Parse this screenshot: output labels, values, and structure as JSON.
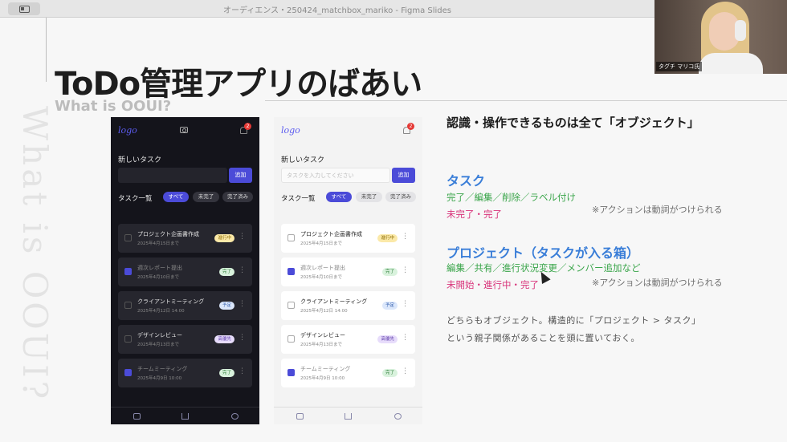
{
  "window": {
    "title": "オーディエンス・250424_matchbox_mariko - Figma Slides"
  },
  "slide": {
    "vertical_text": "What is OOUI?",
    "title": "ToDo管理アプリのばあい",
    "subtitle": "What is OOUI?",
    "heading": "認識・操作できるものは全て「オブジェクト」",
    "task_section": {
      "title": "タスク",
      "actions": "完了／編集／削除／ラベル付け",
      "states": "未完了・完了",
      "note": "※アクションは動詞がつけられる"
    },
    "project_section": {
      "title": "プロジェクト（タスクが入る箱）",
      "actions": "編集／共有／進行状況変更／メンバー追加など",
      "states": "未開始・進行中・完了",
      "note": "※アクションは動詞がつけられる"
    },
    "body_line1": "どちらもオブジェクト。構造的に「プロジェクト > タスク」",
    "body_line2": "という親子関係があることを頭に置いておく。"
  },
  "phone": {
    "logo": "logo",
    "badge": "2",
    "new_task_label": "新しいタスク",
    "input_placeholder": "タスクを入力してください",
    "add_button": "追加",
    "list_label": "タスク一覧",
    "filters": [
      "すべて",
      "未完了",
      "完了済み"
    ],
    "tasks": [
      {
        "name": "プロジェクト企画書作成",
        "date": "2025年4月15日まで",
        "badge": "進行中"
      },
      {
        "name": "週次レポート提出",
        "date": "2025年4月10日まで",
        "badge": "完了"
      },
      {
        "name": "クライアントミーティング",
        "date": "2025年4月12日 14:00",
        "badge": "予定"
      },
      {
        "name": "デザインレビュー",
        "date": "2025年4月13日まで",
        "badge": "高優先"
      },
      {
        "name": "チームミーティング",
        "date": "2025年4月9日 10:00",
        "badge": "完了"
      }
    ],
    "more": "⋮"
  },
  "webcam": {
    "name": "タグチ マリコ氏"
  }
}
